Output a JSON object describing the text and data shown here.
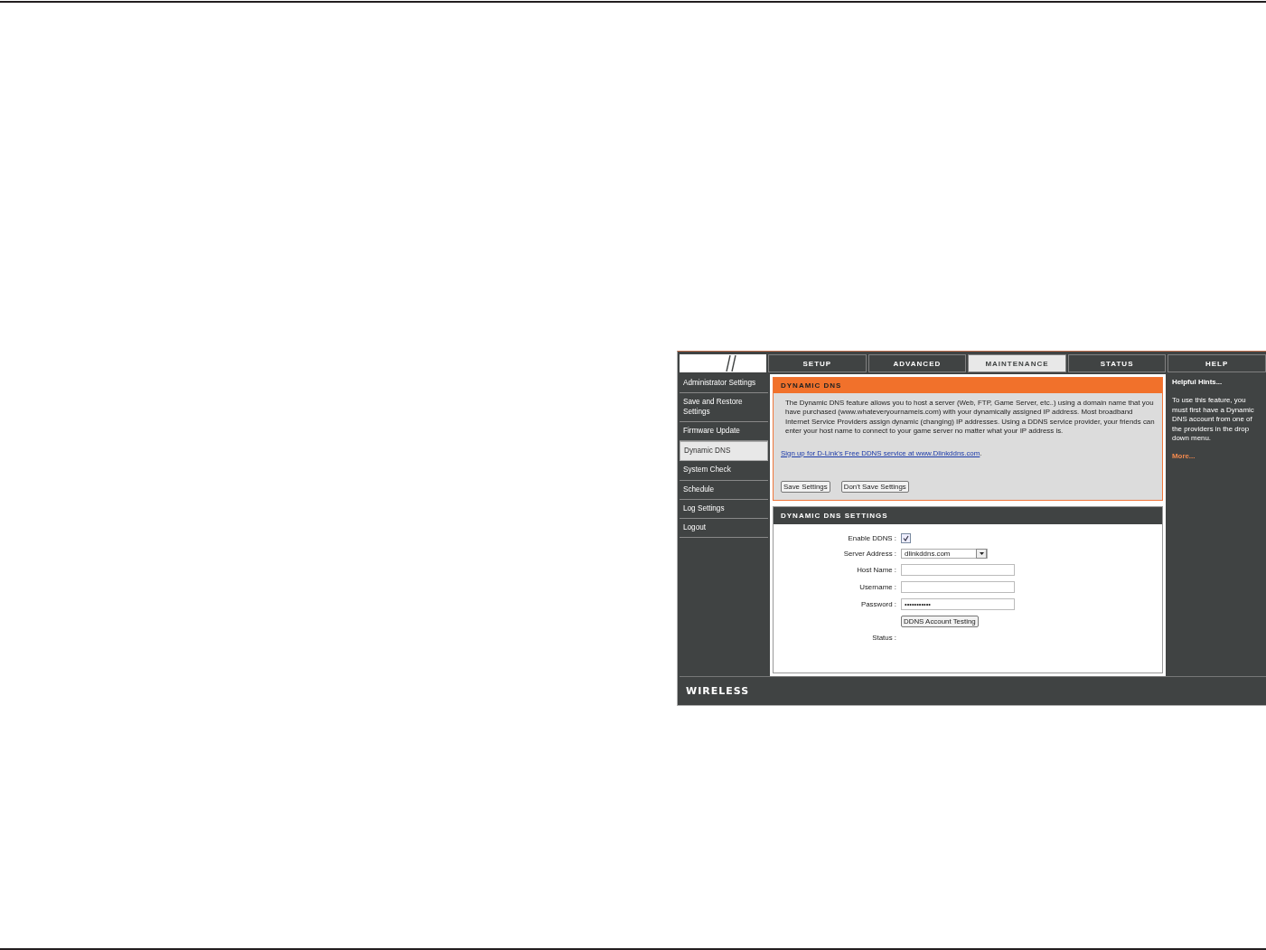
{
  "tabs": [
    {
      "label": "SETUP",
      "selected": false
    },
    {
      "label": "ADVANCED",
      "selected": false
    },
    {
      "label": "MAINTENANCE",
      "selected": true
    },
    {
      "label": "STATUS",
      "selected": false
    },
    {
      "label": "HELP",
      "selected": false
    }
  ],
  "sidebar": {
    "items": [
      {
        "label": "Administrator Settings",
        "selected": false
      },
      {
        "label": "Save and Restore Settings",
        "selected": false
      },
      {
        "label": "Firmware Update",
        "selected": false
      },
      {
        "label": "Dynamic DNS",
        "selected": true
      },
      {
        "label": "System Check",
        "selected": false
      },
      {
        "label": "Schedule",
        "selected": false
      },
      {
        "label": "Log Settings",
        "selected": false
      },
      {
        "label": "Logout",
        "selected": false
      }
    ]
  },
  "intro": {
    "title": "DYNAMIC DNS",
    "description": "The Dynamic DNS feature allows you to host a server (Web, FTP, Game Server, etc..) using a domain name that you have purchased (www.whateveryournameis.com) with your dynamically assigned IP address. Most broadband Internet Service Providers assign dynamic (changing) IP addresses. Using a DDNS service provider, your friends can enter your host name to connect to your game server no matter what your IP address is.",
    "link": "Sign up for D-Link's Free DDNS service at www.Dlinkddns.com",
    "link_suffix": ".",
    "buttons": [
      "Save Settings",
      "Don't Save Settings"
    ]
  },
  "settings": {
    "title": "DYNAMIC DNS SETTINGS",
    "rows": [
      {
        "kind": "checkbox",
        "label": "Enable DDNS :",
        "checked": true
      },
      {
        "kind": "select",
        "label": "Server Address :",
        "value": "dlinkddns.com"
      },
      {
        "kind": "text",
        "label": "Host Name :"
      },
      {
        "kind": "text",
        "label": "Username :"
      },
      {
        "kind": "text",
        "label": "Password :",
        "value": "•••••••••••"
      },
      {
        "kind": "button",
        "text": "DDNS Account Testing"
      },
      {
        "kind": "static",
        "label": "Status :"
      }
    ]
  },
  "help": {
    "title": "Helpful Hints...",
    "text": "To use this feature, you must first have a Dynamic DNS account from one of the providers in the drop down menu.",
    "more": "More..."
  },
  "footer": {
    "brand": "WIRELESS"
  }
}
